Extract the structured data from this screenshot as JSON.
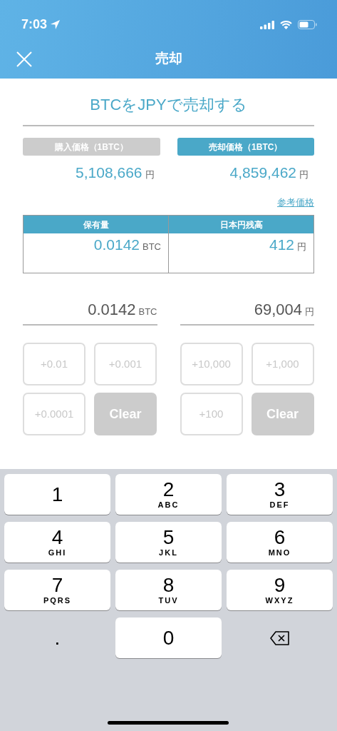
{
  "status_bar": {
    "time": "7:03"
  },
  "nav": {
    "title": "売却"
  },
  "heading": "BTCをJPYで売却する",
  "price_tabs": [
    {
      "label": "購入価格（1BTC）",
      "selected": false,
      "value": "5,108,666",
      "unit": "円"
    },
    {
      "label": "売却価格（1BTC）",
      "selected": true,
      "value": "4,859,462",
      "unit": "円"
    }
  ],
  "reference_link": "参考価格",
  "balance_table": {
    "columns": [
      "保有量",
      "日本円残高"
    ],
    "cells": [
      {
        "value": "0.0142",
        "unit": "BTC"
      },
      {
        "value": "412",
        "unit": "円"
      }
    ]
  },
  "amount_inputs": [
    {
      "value": "0.0142",
      "unit": "BTC",
      "buttons": [
        {
          "label": "+0.01",
          "kind": "add"
        },
        {
          "label": "+0.001",
          "kind": "add"
        },
        {
          "label": "+0.0001",
          "kind": "add"
        },
        {
          "label": "Clear",
          "kind": "clear"
        }
      ]
    },
    {
      "value": "69,004",
      "unit": "円",
      "buttons": [
        {
          "label": "+10,000",
          "kind": "add"
        },
        {
          "label": "+1,000",
          "kind": "add"
        },
        {
          "label": "+100",
          "kind": "add"
        },
        {
          "label": "Clear",
          "kind": "clear"
        }
      ]
    }
  ],
  "keyboard": {
    "keys": [
      {
        "digit": "1",
        "kind": "digit"
      },
      {
        "digit": "2",
        "letters": "ABC",
        "kind": "digit"
      },
      {
        "digit": "3",
        "letters": "DEF",
        "kind": "digit"
      },
      {
        "digit": "4",
        "letters": "GHI",
        "kind": "digit"
      },
      {
        "digit": "5",
        "letters": "JKL",
        "kind": "digit"
      },
      {
        "digit": "6",
        "letters": "MNO",
        "kind": "digit"
      },
      {
        "digit": "7",
        "letters": "PQRS",
        "kind": "digit"
      },
      {
        "digit": "8",
        "letters": "TUV",
        "kind": "digit"
      },
      {
        "digit": "9",
        "letters": "WXYZ",
        "kind": "digit"
      },
      {
        "digit": ".",
        "kind": "plain"
      },
      {
        "digit": "0",
        "kind": "digit"
      },
      {
        "kind": "backspace"
      }
    ]
  }
}
